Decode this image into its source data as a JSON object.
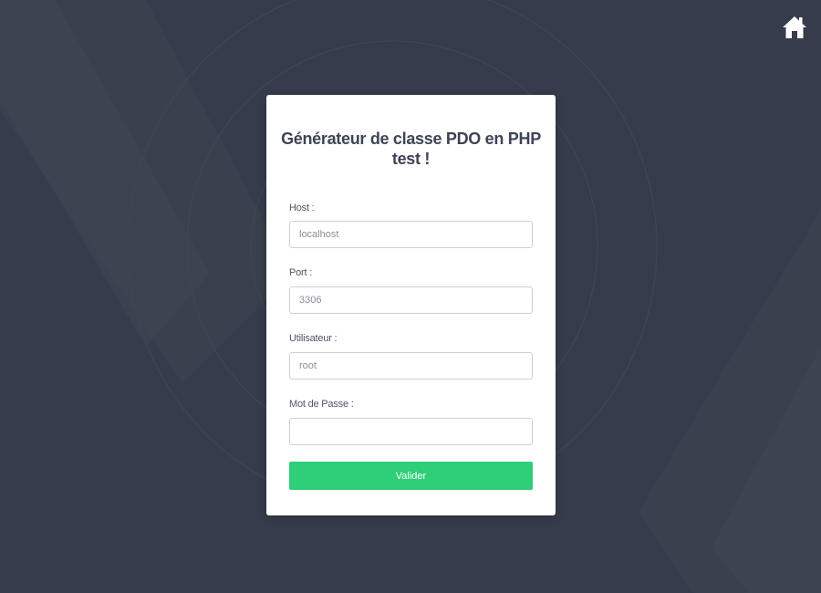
{
  "page": {
    "title_line1": "Générateur de classe PDO en PHP",
    "title_line2": "test !"
  },
  "nav": {
    "home_icon": "home-icon"
  },
  "form": {
    "host_label": "Host :",
    "host_placeholder": "localhost",
    "port_label": "Port :",
    "port_placeholder": "3306",
    "user_label": "Utilisateur :",
    "user_placeholder": "root",
    "password_label": "Mot de Passe :",
    "password_placeholder": "",
    "submit_label": "Valider"
  },
  "colors": {
    "background": "#363c4b",
    "card": "#ffffff",
    "accent": "#2fce78",
    "title_text": "#3d4456"
  }
}
